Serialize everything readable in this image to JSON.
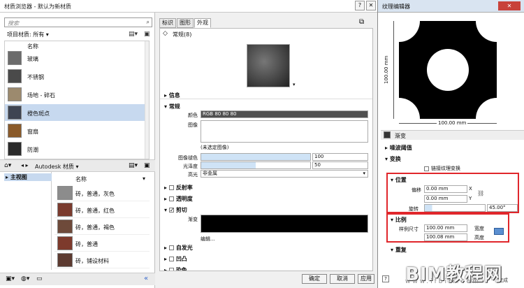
{
  "window": {
    "title": "材质浏览器 - 默认为新材质",
    "help": "?",
    "close": "✕"
  },
  "left": {
    "search_placeholder": "搜索",
    "filter_label": "项目材质: 所有",
    "header_name": "名称",
    "materials": [
      {
        "name": "玻璃",
        "color": "#6b6b6b"
      },
      {
        "name": "不锈钢",
        "color": "#4a4a4a"
      },
      {
        "name": "场地 - 碎石",
        "color": "#9c8a6e"
      },
      {
        "name": "橙色斑点",
        "color": "#3e4452"
      },
      {
        "name": "窗扇",
        "color": "#8a5a2a"
      },
      {
        "name": "防潮",
        "color": "#2a2a2a"
      }
    ],
    "library_label": "Autodesk 材质",
    "tree_item": "主视图",
    "lib_header": "名称",
    "library": [
      {
        "name": "砖，普通，灰色",
        "color": "#8c8c8c"
      },
      {
        "name": "砖，普通，红色",
        "color": "#7a3b2e"
      },
      {
        "name": "砖，普通，褐色",
        "color": "#6e4a3a"
      },
      {
        "name": "砖，普通",
        "color": "#7d3a2c"
      },
      {
        "name": "砖，铺设材料",
        "color": "#5c3a30"
      }
    ]
  },
  "middle": {
    "tabs": [
      "标识",
      "图形",
      "外观"
    ],
    "asset_name": "常规(8)",
    "sections": {
      "info": "信息",
      "general": "常规",
      "reflect": "反射率",
      "transparency": "透明度",
      "cutout": "剪切",
      "selfillum": "自发光",
      "bump": "凹凸",
      "tint": "染色"
    },
    "color_label": "颜色",
    "color_value": "RGB 80 80 80",
    "image_label": "图像",
    "image_none": "(未选定图像)",
    "fade_label": "图像褪色",
    "fade_value": "100",
    "gloss_label": "光泽度",
    "gloss_value": "50",
    "highlight_label": "高光",
    "highlight_value": "非金属",
    "cutout_label": "渐变",
    "edit_link": "编辑...",
    "buttons": {
      "ok": "确定",
      "cancel": "取消",
      "apply": "应用"
    }
  },
  "texture": {
    "title": "纹理编辑器",
    "ruler_h": "100.00 mm",
    "ruler_v": "100.00 mm",
    "gradient": "渐变",
    "sec_noise": "噪波阈值",
    "sec_transform": "变换",
    "link_label": "链接纹理变换",
    "sec_position": "位置",
    "offset_label": "偏移",
    "offset_x": "0.00 mm",
    "offset_y": "0.00 mm",
    "axis_x": "X",
    "axis_y": "Y",
    "rotate_label": "旋转",
    "rotate_value": "45.00°",
    "sec_scale": "比例",
    "sample_label": "样例尺寸",
    "width_value": "100.00 mm",
    "width_label": "宽度",
    "height_value": "100.08 mm",
    "height_label": "高度",
    "sec_repeat": "重复",
    "done": "完成"
  },
  "watermark": {
    "main": "BIM教程网",
    "url": "www.ifbim.com"
  }
}
